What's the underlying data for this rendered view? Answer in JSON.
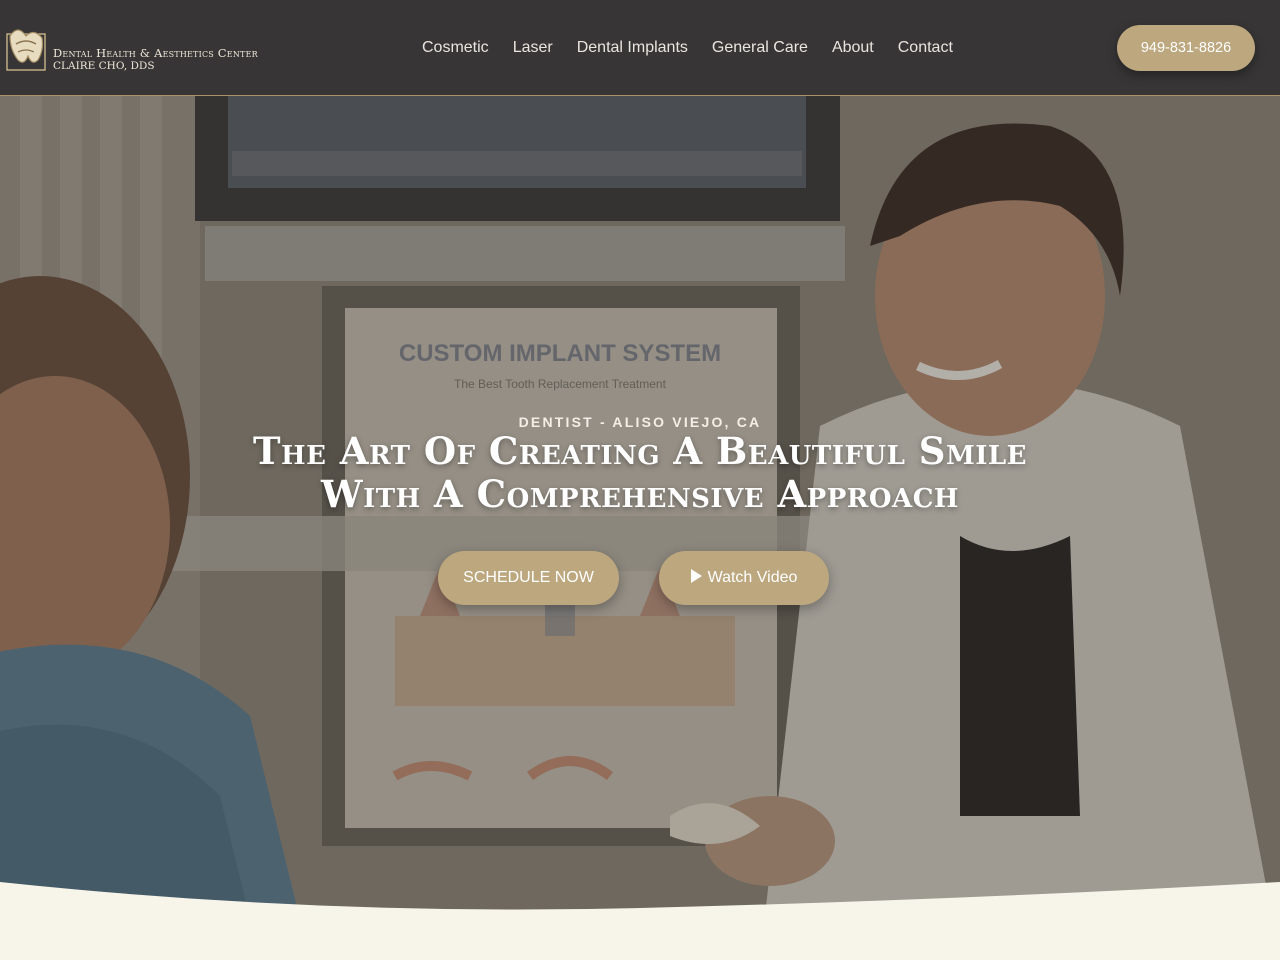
{
  "header": {
    "logo": {
      "line1": "Dental Health & Aesthetics Center",
      "line2": "CLAIRE CHO, DDS"
    },
    "nav": [
      {
        "label": "Cosmetic"
      },
      {
        "label": "Laser"
      },
      {
        "label": "Dental Implants"
      },
      {
        "label": "General Care"
      },
      {
        "label": "About"
      },
      {
        "label": "Contact"
      }
    ],
    "phone": "949-831-8826"
  },
  "hero": {
    "subtitle": "DENTIST - ALISO VIEJO, CA",
    "title_line1": "The Art Of Creating A Beautiful Smile",
    "title_line2": "With A Comprehensive Approach",
    "schedule_label": "SCHEDULE NOW",
    "video_label": "Watch Video",
    "poster_heading": "CUSTOM IMPLANT SYSTEM",
    "poster_sub": "The Best Tooth Replacement Treatment"
  },
  "colors": {
    "header_bg": "#373535",
    "accent_gold": "#bca77e",
    "page_bg": "#f7f4ea"
  },
  "icons": {
    "logo": "dental-logo-icon",
    "play": "play-icon"
  }
}
